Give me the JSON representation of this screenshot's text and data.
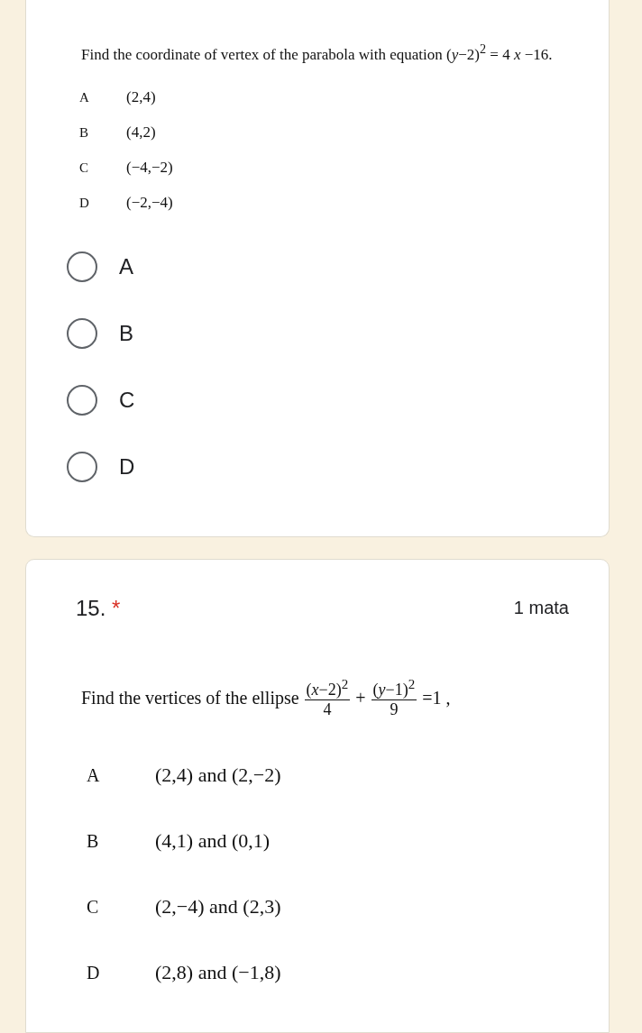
{
  "questions": [
    {
      "prompt": [
        {
          "kind": "text",
          "text": "Find the coordinate of vertex of the parabola with equation (*y*−2)$^{2}$ = 4 *x* −16."
        }
      ],
      "image_options": [
        {
          "letter": "A",
          "answer": "(2,4)"
        },
        {
          "letter": "B",
          "answer": "(4,2)"
        },
        {
          "letter": "C",
          "answer": "(−4,−2)"
        },
        {
          "letter": "D",
          "answer": "(−2,−4)"
        }
      ],
      "choices": [
        {
          "label": "A",
          "selected": false
        },
        {
          "label": "B",
          "selected": false
        },
        {
          "label": "C",
          "selected": false
        },
        {
          "label": "D",
          "selected": false
        }
      ]
    },
    {
      "number": "15.",
      "required_mark": "*",
      "points": "1 mata",
      "prompt": [
        {
          "kind": "text",
          "text": "Find the vertices of the ellipse"
        },
        {
          "kind": "frac",
          "numerator": "(*x*−2)$^{2}$",
          "denominator": "4"
        },
        {
          "kind": "text",
          "text": "+"
        },
        {
          "kind": "frac",
          "numerator": "(*y*−1)$^{2}$",
          "denominator": "9"
        },
        {
          "kind": "text",
          "text": "=1 ,"
        }
      ],
      "image_options": [
        {
          "letter": "A",
          "answer": "(2,4) and (2,−2)"
        },
        {
          "letter": "B",
          "answer": "(4,1) and (0,1)"
        },
        {
          "letter": "C",
          "answer": "(2,−4) and (2,3)"
        },
        {
          "letter": "D",
          "answer": "(2,8) and (−1,8)"
        }
      ]
    }
  ]
}
